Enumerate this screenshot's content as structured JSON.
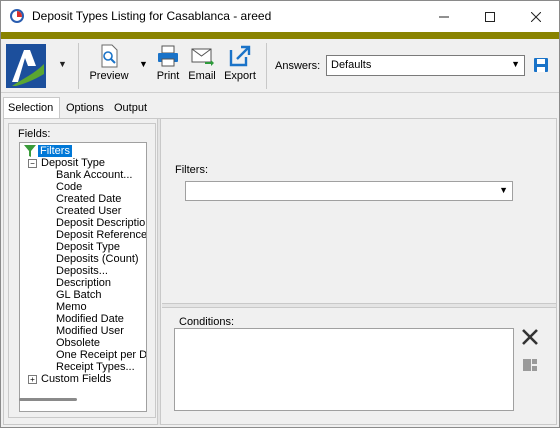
{
  "window": {
    "title": "Deposit Types Listing for Casablanca - areed",
    "controls": [
      "minimize-icon",
      "maximize-icon",
      "close-icon"
    ]
  },
  "colors": {
    "accent_bar": "#898300",
    "selection": "#0078d7",
    "logo_blue": "#1c4f9c",
    "logo_green": "#5aa632",
    "toolbar_icon_blue": "#1a73c8"
  },
  "toolbar": {
    "preview_label": "Preview",
    "print_label": "Print",
    "email_label": "Email",
    "export_label": "Export",
    "answers_label": "Answers:",
    "answers_value": "Defaults"
  },
  "tabs": [
    {
      "label": "Selection",
      "active": true
    },
    {
      "label": "Options",
      "active": false
    },
    {
      "label": "Output",
      "active": false
    }
  ],
  "fields": {
    "label": "Fields:",
    "root": "Filters",
    "groups": [
      {
        "label": "Deposit Type",
        "expanded": true,
        "items": [
          "Bank Account...",
          "Code",
          "Created Date",
          "Created User",
          "Deposit Description",
          "Deposit Reference",
          "Deposit Type",
          "Deposits (Count)",
          "Deposits...",
          "Description",
          "GL Batch",
          "Memo",
          "Modified Date",
          "Modified User",
          "Obsolete",
          "One Receipt per Deposit",
          "Receipt Types..."
        ]
      },
      {
        "label": "Custom Fields",
        "expanded": false,
        "items": []
      }
    ]
  },
  "filters": {
    "label": "Filters:",
    "value": ""
  },
  "conditions": {
    "label": "Conditions:"
  }
}
